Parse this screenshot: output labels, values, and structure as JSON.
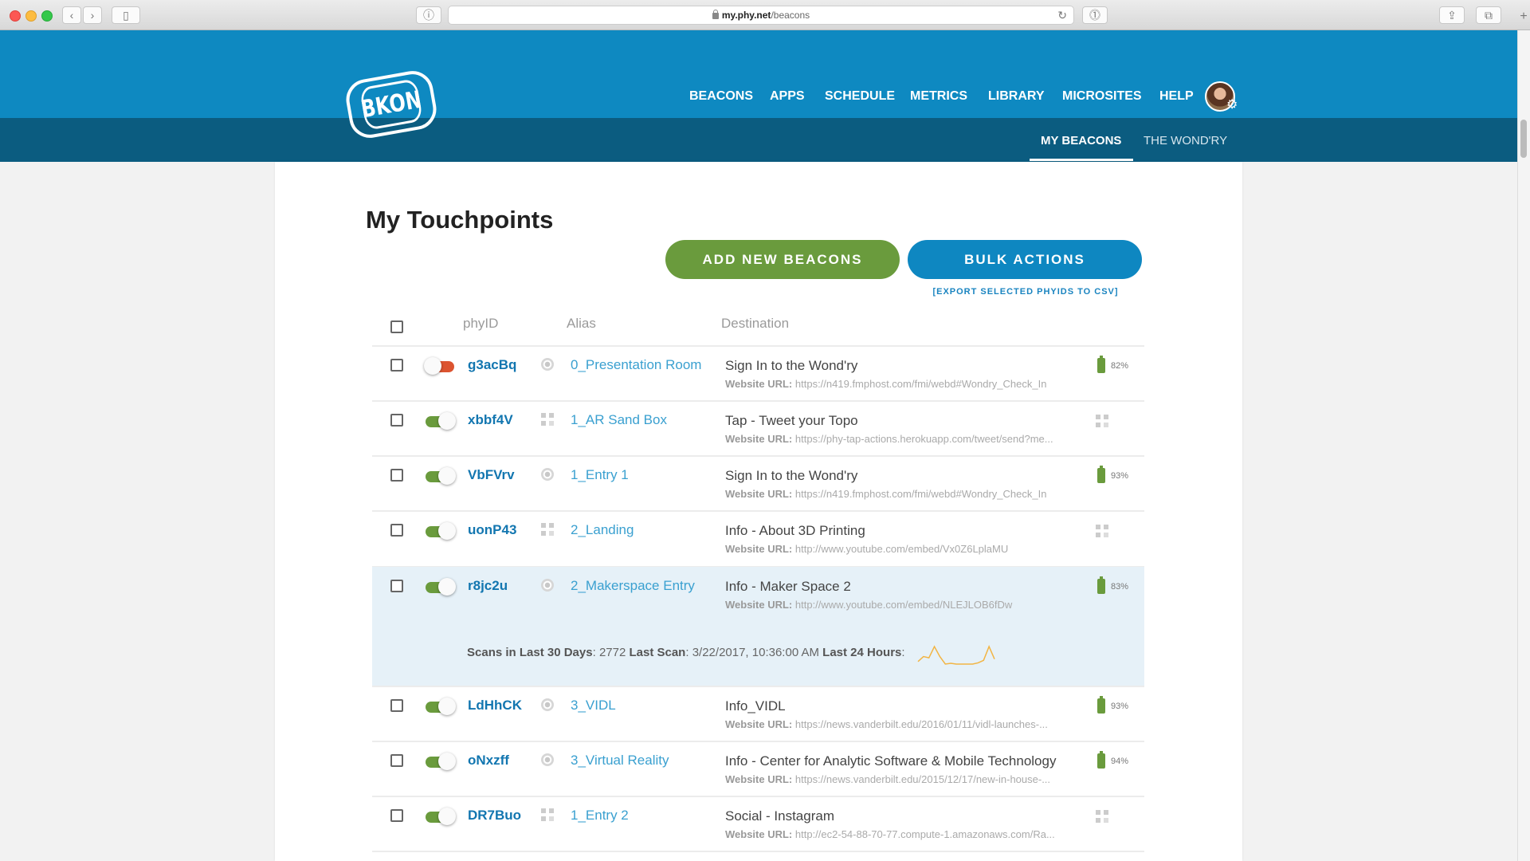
{
  "browser": {
    "url_host": "my.phy.net",
    "url_path": "/beacons"
  },
  "header": {
    "logo_text": "BKON",
    "nav": [
      "BEACONS",
      "APPS",
      "SCHEDULE",
      "METRICS",
      "LIBRARY",
      "MICROSITES",
      "HELP"
    ],
    "subtabs": [
      {
        "label": "MY BEACONS",
        "active": true
      },
      {
        "label": "THE WOND'RY",
        "active": false
      }
    ]
  },
  "main": {
    "title": "My Touchpoints",
    "add_button": "ADD NEW BEACONS",
    "bulk_button": "BULK ACTIONS",
    "export_link": "[EXPORT SELECTED PHYIDS TO CSV]",
    "columns": {
      "phyid": "phyID",
      "alias": "Alias",
      "destination": "Destination"
    },
    "url_label": "Website URL:",
    "rows": [
      {
        "phyid": "g3acBq",
        "enabled": false,
        "type": "beacon",
        "alias": "0_Presentation Room",
        "destination": "Sign In to the Wond'ry",
        "url": "https://n419.fmphost.com/fmi/webd#Wondry_Check_In",
        "battery": "82%"
      },
      {
        "phyid": "xbbf4V",
        "enabled": true,
        "type": "qr",
        "alias": "1_AR Sand Box",
        "destination": "Tap - Tweet your Topo",
        "url": "https://phy-tap-actions.herokuapp.com/tweet/send?me...",
        "battery": null
      },
      {
        "phyid": "VbFVrv",
        "enabled": true,
        "type": "beacon",
        "alias": "1_Entry 1",
        "destination": "Sign In to the Wond'ry",
        "url": "https://n419.fmphost.com/fmi/webd#Wondry_Check_In",
        "battery": "93%"
      },
      {
        "phyid": "uonP43",
        "enabled": true,
        "type": "qr",
        "alias": "2_Landing",
        "destination": "Info - About 3D Printing",
        "url": "http://www.youtube.com/embed/Vx0Z6LplaMU",
        "battery": null
      },
      {
        "phyid": "r8jc2u",
        "enabled": true,
        "type": "beacon",
        "alias": "2_Makerspace Entry",
        "destination": "Info - Maker Space 2",
        "url": "http://www.youtube.com/embed/NLEJLOB6fDw",
        "battery": "83%",
        "expanded": true
      },
      {
        "phyid": "LdHhCK",
        "enabled": true,
        "type": "beacon",
        "alias": "3_VIDL",
        "destination": "Info_VIDL",
        "url": "https://news.vanderbilt.edu/2016/01/11/vidl-launches-...",
        "battery": "93%"
      },
      {
        "phyid": "oNxzff",
        "enabled": true,
        "type": "beacon",
        "alias": "3_Virtual Reality",
        "destination": "Info - Center for Analytic Software & Mobile Technology",
        "url": "https://news.vanderbilt.edu/2015/12/17/new-in-house-...",
        "battery": "94%"
      },
      {
        "phyid": "DR7Buo",
        "enabled": true,
        "type": "qr",
        "alias": "1_Entry 2",
        "destination": "Social - Instagram",
        "url": "http://ec2-54-88-70-77.compute-1.amazonaws.com/Ra...",
        "battery": null
      }
    ],
    "stats": {
      "scans_label": "Scans in Last 30 Days",
      "scans_value": "2772",
      "last_scan_label": "Last Scan",
      "last_scan_value": "3/22/2017, 10:36:00 AM",
      "last24_label": "Last 24 Hours",
      "last24_series": [
        1,
        3,
        2.5,
        7,
        3,
        0,
        0.3,
        0,
        0,
        0,
        0,
        0.5,
        1.5,
        7,
        2
      ]
    }
  },
  "colors": {
    "brand_blue": "#0e89c1",
    "brand_dark": "#0b5c80",
    "green": "#6a9b3d",
    "toggle_off": "#dc5430",
    "sparkline": "#f2b544"
  }
}
